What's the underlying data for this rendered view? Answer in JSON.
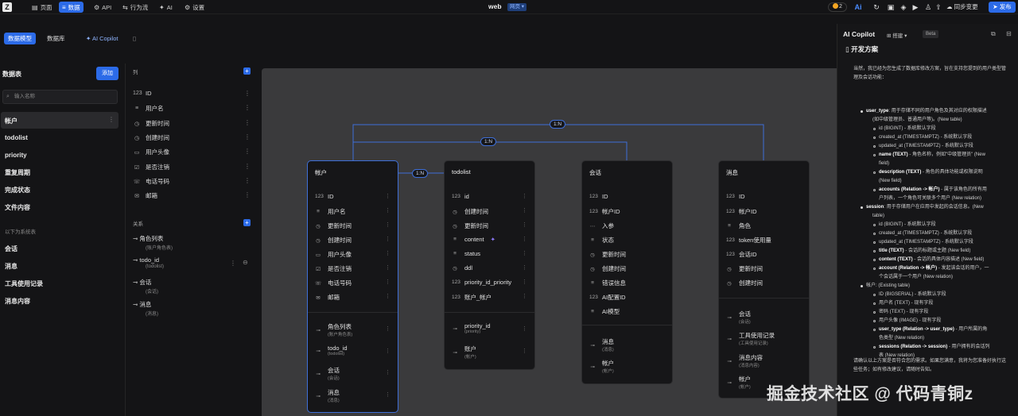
{
  "topbar": {
    "logo": "Z",
    "nav": [
      {
        "label": "页面",
        "icon": "pages-icon"
      },
      {
        "label": "数据",
        "icon": "database-icon"
      },
      {
        "label": "API",
        "icon": "api-icon"
      },
      {
        "label": "行为流",
        "icon": "flow-icon"
      },
      {
        "label": "AI",
        "icon": "ai-icon"
      },
      {
        "label": "设置",
        "icon": "gear-icon"
      }
    ],
    "app_title": "web",
    "env_badge": "网页",
    "credits": "2",
    "sync_label": "同步变更",
    "publish_label": "发布"
  },
  "subbar": {
    "tab_model": "数据模型",
    "tab_db": "数据库",
    "copilot_link": "AI Copilot"
  },
  "tables_panel": {
    "title": "数据表",
    "add_label": "添加",
    "search_placeholder": "输入名称",
    "tables": [
      "帐户",
      "todolist",
      "priority",
      "重复周期",
      "完成状态",
      "文件内容"
    ],
    "system_label": "以下为系统表",
    "system_tables": [
      "会话",
      "消息",
      "工具使用记录",
      "消息内容"
    ]
  },
  "columns_panel": {
    "title": "列",
    "columns": [
      "ID",
      "用户名",
      "更新时间",
      "创建时间",
      "用户头像",
      "是否注销",
      "电话号码",
      "邮箱"
    ],
    "relations_title": "关系",
    "relations": [
      {
        "name": "角色列表",
        "sub": "(账户角色表)"
      },
      {
        "name": "todo_id",
        "sub": "(todolist)"
      },
      {
        "name": "会话",
        "sub": "(会话)"
      },
      {
        "name": "消息",
        "sub": "(消息)"
      }
    ]
  },
  "diagram": {
    "edge_labels": [
      "1:N",
      "1:N",
      "1:N"
    ],
    "cards": {
      "account": {
        "title": "帐户",
        "fields": [
          "ID",
          "用户名",
          "更新时间",
          "创建时间",
          "用户头像",
          "是否注销",
          "电话号码",
          "邮箱"
        ],
        "relations": [
          {
            "name": "角色列表",
            "sub": "(账户角色表)"
          },
          {
            "name": "todo_id",
            "sub": "(todolist)"
          },
          {
            "name": "会话",
            "sub": "(会话)"
          },
          {
            "name": "消息",
            "sub": "(消息)"
          }
        ]
      },
      "todolist": {
        "title": "todolist",
        "fields": [
          "id",
          "创建时间",
          "更新时间",
          "content",
          "status",
          "ddl",
          "priority_id_priority",
          "账户_帐户"
        ],
        "relations": [
          {
            "name": "priority_id",
            "sub": "(priority)"
          },
          {
            "name": "账户",
            "sub": "(帐户)"
          }
        ]
      },
      "session": {
        "title": "会话",
        "fields": [
          "ID",
          "帐户ID",
          "入参",
          "状态",
          "更新时间",
          "创建时间",
          "错误信息",
          "AI配置ID",
          "AI模型"
        ],
        "relations": [
          {
            "name": "消息",
            "sub": "(消息)"
          },
          {
            "name": "帐户",
            "sub": "(帐户)"
          }
        ]
      },
      "message": {
        "title": "消息",
        "fields": [
          "ID",
          "帐户ID",
          "角色",
          "token使用量",
          "会话ID",
          "更新时间",
          "创建时间"
        ],
        "relations": [
          {
            "name": "会话",
            "sub": "(会话)"
          },
          {
            "name": "工具使用记录",
            "sub": "(工具使用记录)"
          },
          {
            "name": "消息内容",
            "sub": "(消息内容)"
          },
          {
            "name": "帐户",
            "sub": "(帐户)"
          }
        ]
      }
    }
  },
  "copilot": {
    "title": "AI Copilot",
    "mode": "搭建",
    "beta": "Beta",
    "heading": "开发方案",
    "intro": "当然，我已经为您生成了数据库修改方案，旨在支持您提到的用户类型管理及会话功能：",
    "lines": [
      {
        "b": "user_type",
        "t": ": 用于存储不同的用户角色及其对应的权限描述"
      },
      {
        "b": "",
        "t": "(如中级管理员、普通用户等)。(New table)"
      },
      {
        "b": "",
        "t": "id (BIGINT) - 系统默认字段"
      },
      {
        "b": "",
        "t": "created_at (TIMESTAMPTZ) - 系统默认字段"
      },
      {
        "b": "",
        "t": "updated_at (TIMESTAMPTZ) - 系统默认字段"
      },
      {
        "b": "name (TEXT)",
        "t": " - 角色名称，例如\"中级管理员\" (New"
      },
      {
        "b": "",
        "t": "field)"
      },
      {
        "b": "description (TEXT)",
        "t": " - 角色的具体功能或权限说明"
      },
      {
        "b": "",
        "t": "(New field)"
      },
      {
        "b": "accounts (Relation -> 帐户)",
        "t": " - 属于该角色的所有用"
      },
      {
        "b": "",
        "t": "户列表，一个角色可关联多个用户 (New relation)"
      },
      {
        "b": "session",
        "t": ": 用于存储用户在应用中发起的会话信息。(New"
      },
      {
        "b": "",
        "t": "table)"
      },
      {
        "b": "",
        "t": "id (BIGINT) - 系统默认字段"
      },
      {
        "b": "",
        "t": "created_at (TIMESTAMPTZ) - 系统默认字段"
      },
      {
        "b": "",
        "t": "updated_at (TIMESTAMPTZ) - 系统默认字段"
      },
      {
        "b": "title (TEXT)",
        "t": " - 会话的标题或主题 (New field)"
      },
      {
        "b": "content (TEXT)",
        "t": " - 会话的具体内容描述 (New field)"
      },
      {
        "b": "account (Relation -> 帐户)",
        "t": " - 发起该会话的用户，一"
      },
      {
        "b": "",
        "t": "个会话属于一个用户 (New relation)"
      },
      {
        "b": "",
        "t": "帐户: (Existing table)"
      },
      {
        "b": "",
        "t": "ID (BIGSERIAL) - 系统默认字段"
      },
      {
        "b": "",
        "t": "用户名 (TEXT) - 现有字段"
      },
      {
        "b": "",
        "t": "密码 (TEXT) - 现有字段"
      },
      {
        "b": "",
        "t": "用户头像 (IMAGE) - 现有字段"
      },
      {
        "b": "user_type (Relation -> user_type)",
        "t": " - 用户所属的角"
      },
      {
        "b": "",
        "t": "色类型 (New relation)"
      },
      {
        "b": "sessions (Relation -> session)",
        "t": " - 用户拥有的会话列"
      },
      {
        "b": "",
        "t": "表 (New relation)"
      }
    ],
    "outro": "请确认以上方案是否符合您的需求。如果您满意，我将为您准备好执行这些任务；如有修改建议，请随时告知。"
  },
  "watermark": "掘金技术社区 @ 代码青铜z"
}
